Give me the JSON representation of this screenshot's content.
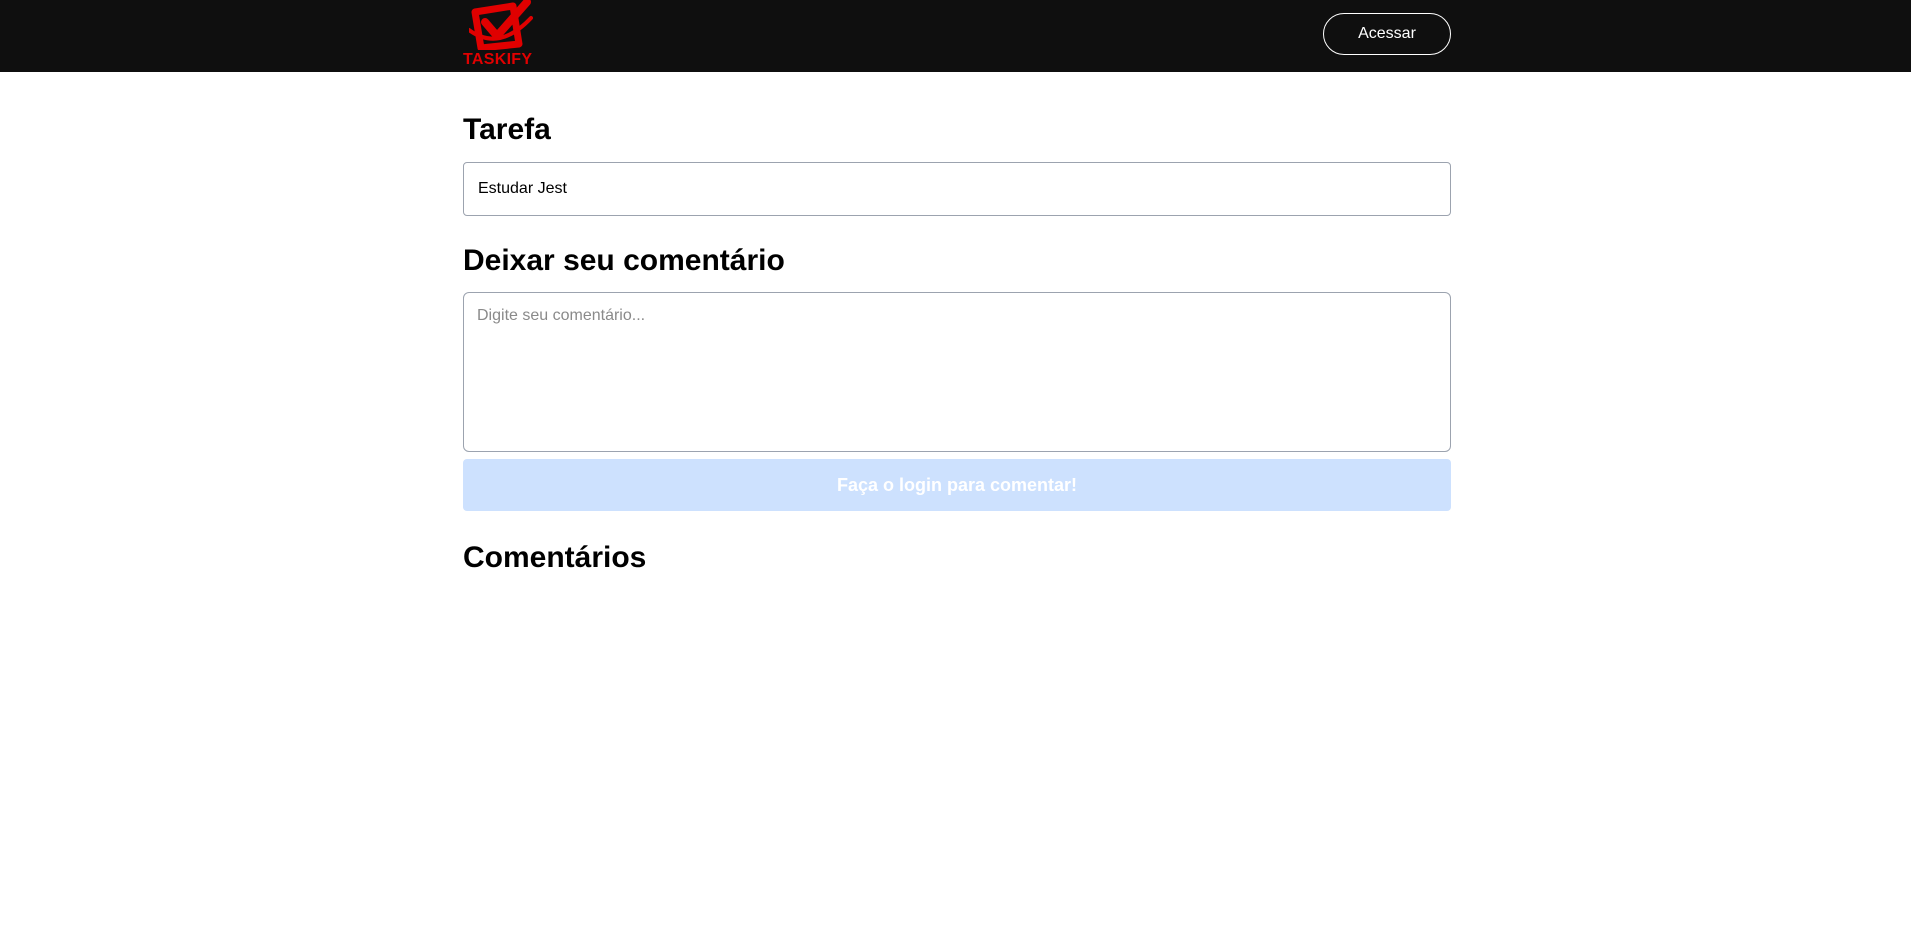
{
  "header": {
    "logo_text": "TASKIFY",
    "access_button": "Acessar"
  },
  "task": {
    "heading": "Tarefa",
    "value": "Estudar Jest"
  },
  "comment_form": {
    "heading": "Deixar seu comentário",
    "placeholder": "Digite seu comentário...",
    "submit_label": "Faça o login para comentar!"
  },
  "comments": {
    "heading": "Comentários"
  },
  "colors": {
    "header_bg": "#0f0f0f",
    "brand_red": "#e00000",
    "disabled_button_bg": "#cde1fe"
  },
  "icons": {
    "logo": "checkbox-check-icon"
  }
}
